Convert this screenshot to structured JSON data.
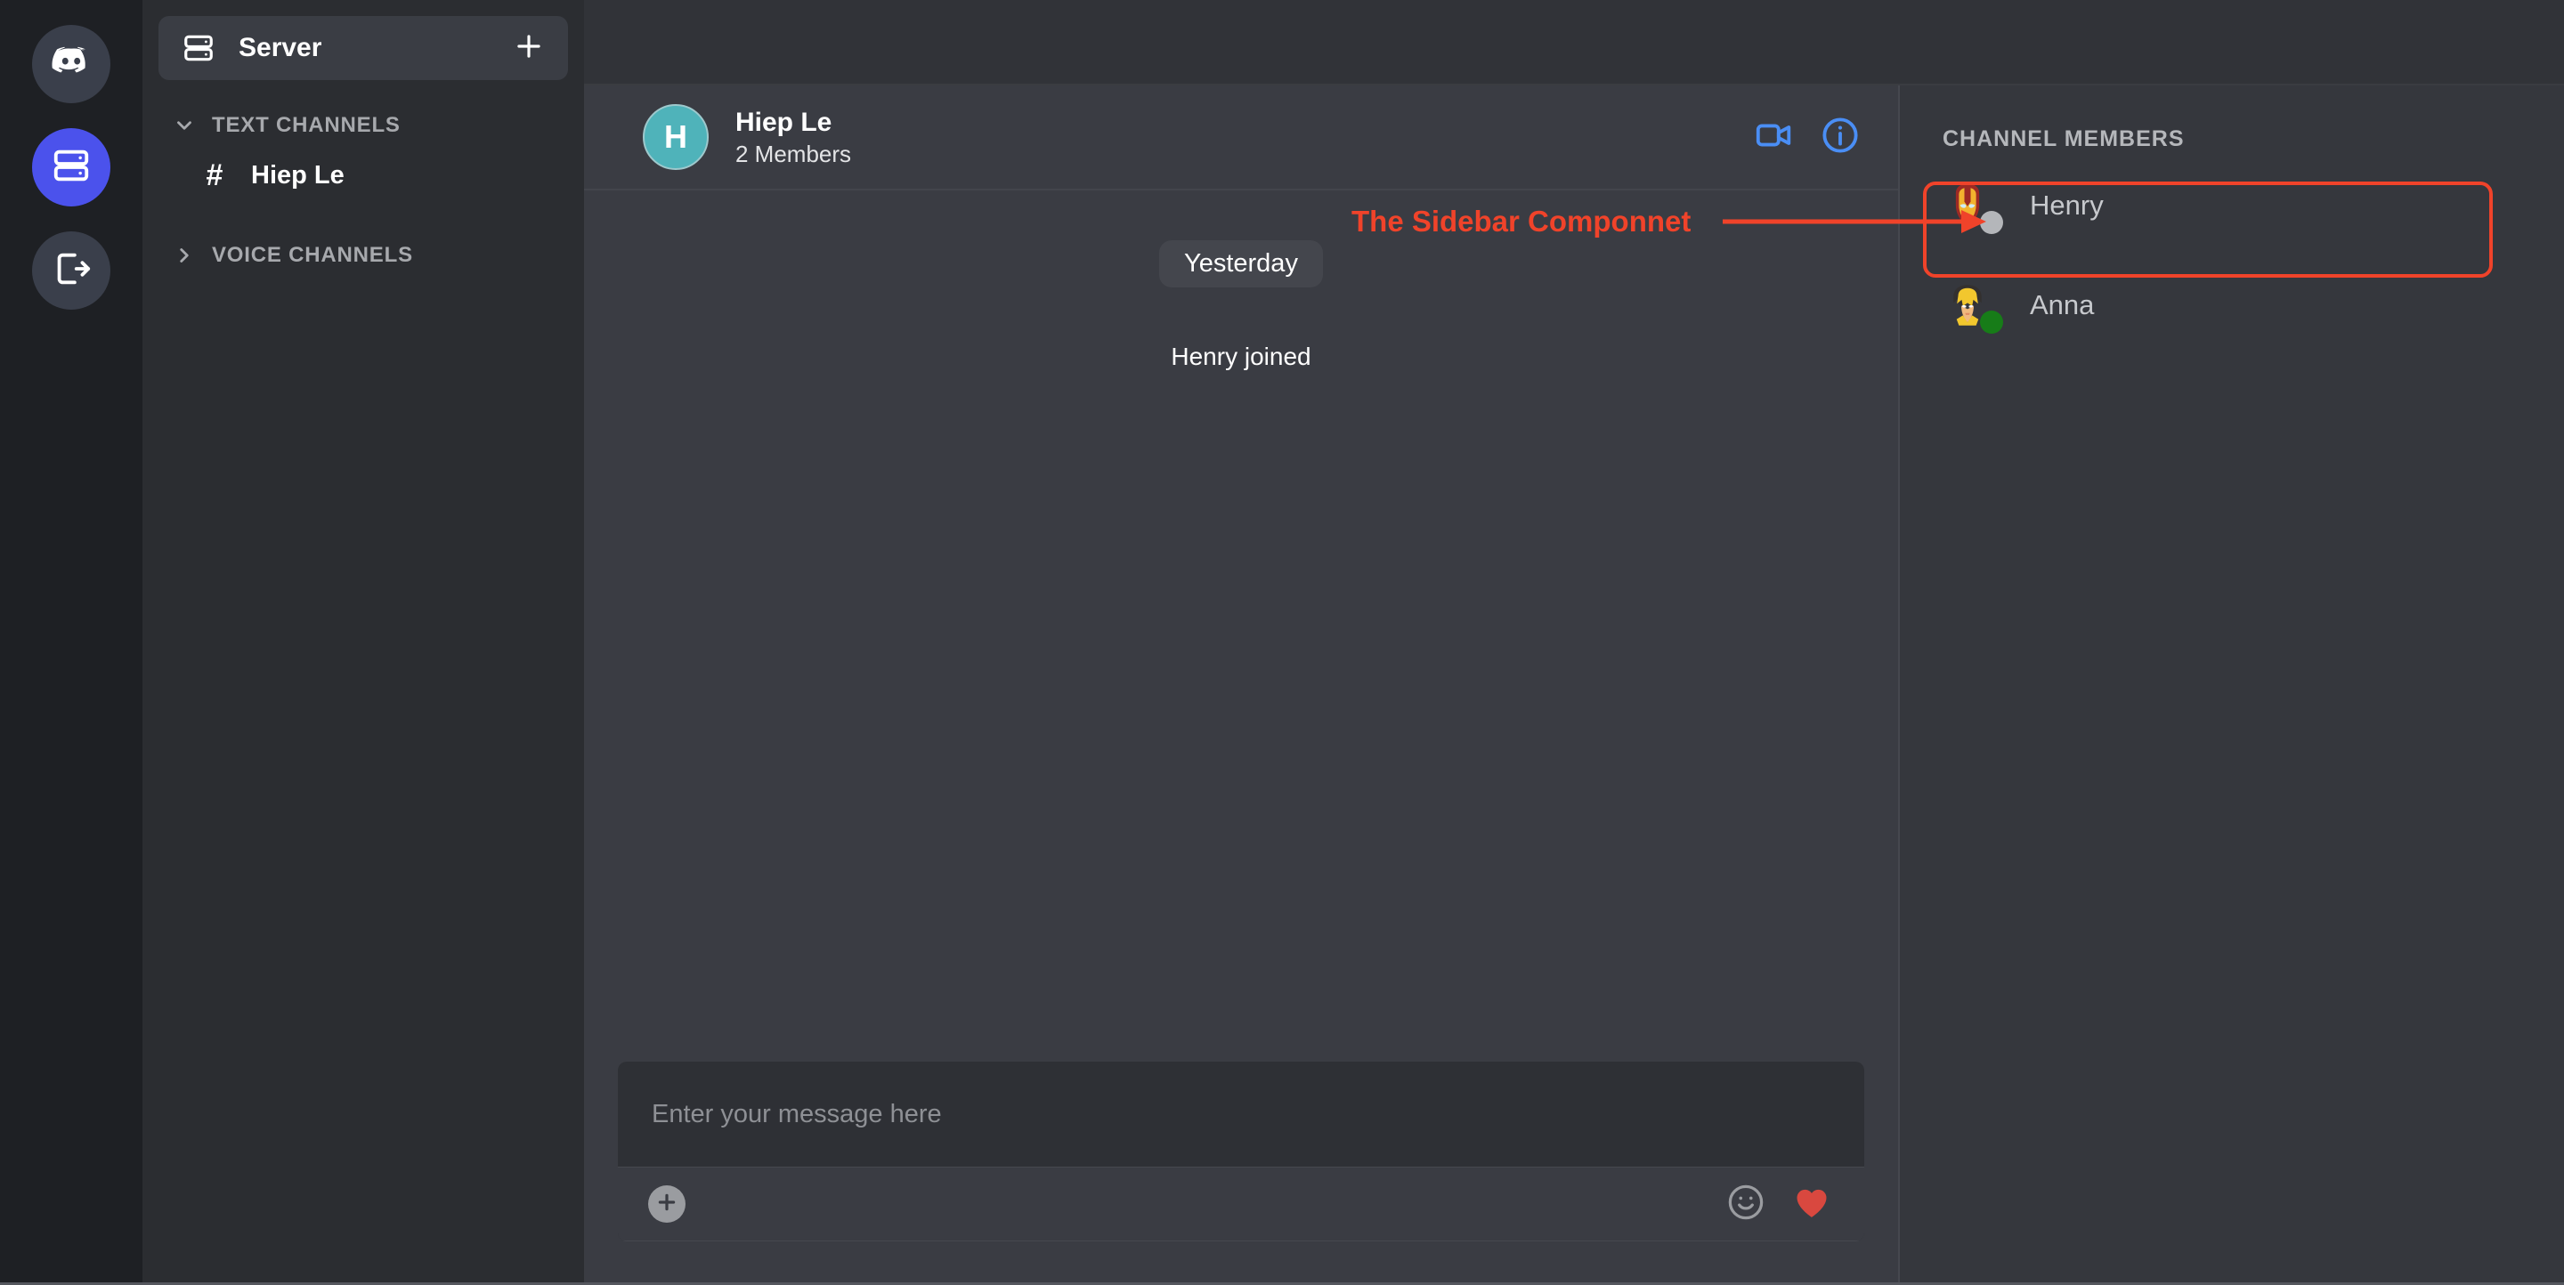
{
  "rail": {
    "items": [
      {
        "name": "discord-logo",
        "icon": "discord-icon",
        "active": false
      },
      {
        "name": "server",
        "icon": "server-rack-icon",
        "active": true
      },
      {
        "name": "logout",
        "icon": "logout-icon",
        "active": false
      }
    ]
  },
  "sidebar": {
    "server_label": "Server",
    "server_icon": "server-rack-icon",
    "add_label": "+",
    "categories": [
      {
        "label": "TEXT CHANNELS",
        "expanded": true,
        "channels": [
          {
            "prefix": "#",
            "label": "Hiep Le",
            "active": true
          }
        ]
      },
      {
        "label": "VOICE CHANNELS",
        "expanded": false,
        "channels": []
      }
    ]
  },
  "chat": {
    "avatar_initial": "H",
    "avatar_color": "#4fb3ba",
    "title": "Hiep Le",
    "subtitle": "2 Members",
    "actions": [
      {
        "name": "video-call-button",
        "icon": "video-camera-icon",
        "color": "#4a8ef5"
      },
      {
        "name": "channel-info-button",
        "icon": "info-circle-icon",
        "color": "#4a8ef5"
      }
    ],
    "date_divider": "Yesterday",
    "system_message": "Henry joined",
    "composer": {
      "placeholder": "Enter your message here",
      "value": "",
      "attach_label": "+",
      "emoji_icon": "smiley-face-icon",
      "like_icon": "heart-icon",
      "like_color": "#d9483f"
    }
  },
  "members": {
    "title": "CHANNEL MEMBERS",
    "list": [
      {
        "name": "Henry",
        "avatar": "ironman-avatar",
        "status": "offline",
        "status_color": "#b4b6ba",
        "highlighted": true
      },
      {
        "name": "Anna",
        "avatar": "wolverine-avatar",
        "status": "online",
        "status_color": "#177c18",
        "highlighted": false
      }
    ]
  },
  "annotation": {
    "text": "The Sidebar Componnet",
    "color": "#f0432a"
  }
}
